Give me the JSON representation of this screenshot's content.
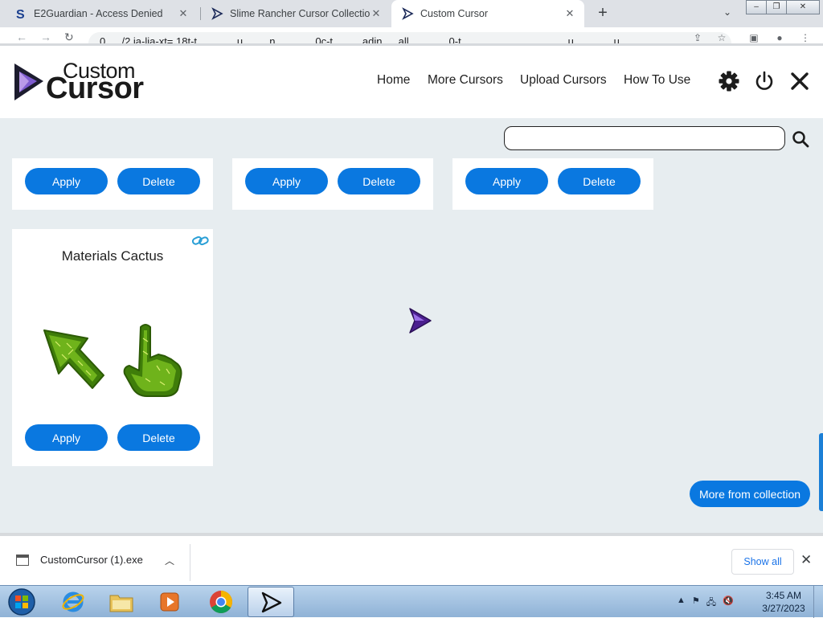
{
  "browser": {
    "tabs": [
      {
        "title": "E2Guardian - Access Denied",
        "active": false
      },
      {
        "title": "Slime Rancher Cursor Collection",
        "active": false
      },
      {
        "title": "Custom Cursor",
        "active": true
      }
    ],
    "new_tab": "+",
    "url": "0 … /2 ja-lia-xt= 18t-t… … … u… … n… … … 0c-t … … adin … all… … … 0-t… … … … … … … … u… … … u… … … … … … … … … … … … … … … … … l"
  },
  "site": {
    "logo_line1": "Custom",
    "logo_line2": "Cursor",
    "nav": [
      "Home",
      "More Cursors",
      "Upload Cursors",
      "How To Use"
    ],
    "search_placeholder": "",
    "cards_top": [
      {
        "apply": "Apply",
        "delete": "Delete"
      },
      {
        "apply": "Apply",
        "delete": "Delete"
      },
      {
        "apply": "Apply",
        "delete": "Delete"
      }
    ],
    "card_cactus": {
      "title": "Materials Cactus",
      "apply": "Apply",
      "delete": "Delete"
    },
    "more_from_collection": "More from collection",
    "accent_color": "#0a78e0"
  },
  "downloads": {
    "file": "CustomCursor (1).exe",
    "show_all": "Show all"
  },
  "taskbar": {
    "time": "3:45 AM",
    "date": "3/27/2023"
  }
}
